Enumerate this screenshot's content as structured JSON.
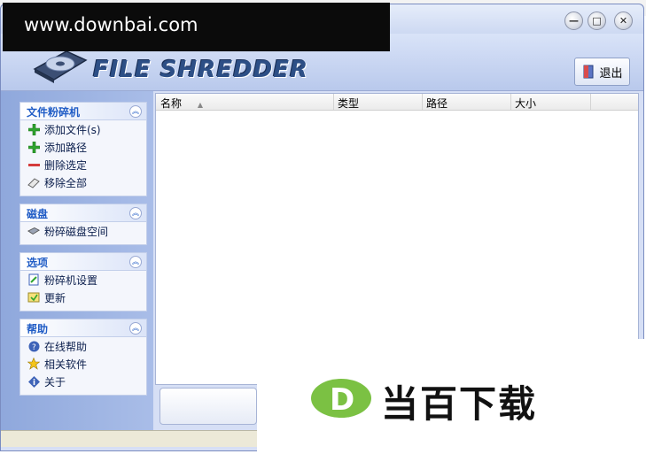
{
  "background_window": {
    "partial_text": "名称"
  },
  "app": {
    "logo_text": "FILE SHREDDER",
    "exit_label": "退出",
    "accent_color": "#215dc6"
  },
  "window_controls": {
    "minimize": "—",
    "maximize": "□",
    "close": "✕"
  },
  "sidebar": {
    "panels": [
      {
        "title": "文件粉碎机",
        "items": [
          {
            "label": "添加文件(s)",
            "icon": "add-icon"
          },
          {
            "label": "添加路径",
            "icon": "add-icon"
          },
          {
            "label": "删除选定",
            "icon": "remove-icon"
          },
          {
            "label": "移除全部",
            "icon": "eraser-icon"
          }
        ]
      },
      {
        "title": "磁盘",
        "items": [
          {
            "label": "粉碎磁盘空间",
            "icon": "disk-icon"
          }
        ]
      },
      {
        "title": "选项",
        "items": [
          {
            "label": "粉碎机设置",
            "icon": "settings-icon"
          },
          {
            "label": "更新",
            "icon": "update-icon"
          }
        ]
      },
      {
        "title": "帮助",
        "items": [
          {
            "label": "在线帮助",
            "icon": "help-icon"
          },
          {
            "label": "相关软件",
            "icon": "star-icon"
          },
          {
            "label": "关于",
            "icon": "info-icon"
          }
        ]
      }
    ]
  },
  "list": {
    "columns": [
      "名称",
      "类型",
      "路径",
      "大小"
    ],
    "sort_indicator": "▲",
    "rows": []
  },
  "watermark": {
    "top": "www.downbai.com",
    "bottom": "当百下载",
    "logo_letter": "D"
  }
}
